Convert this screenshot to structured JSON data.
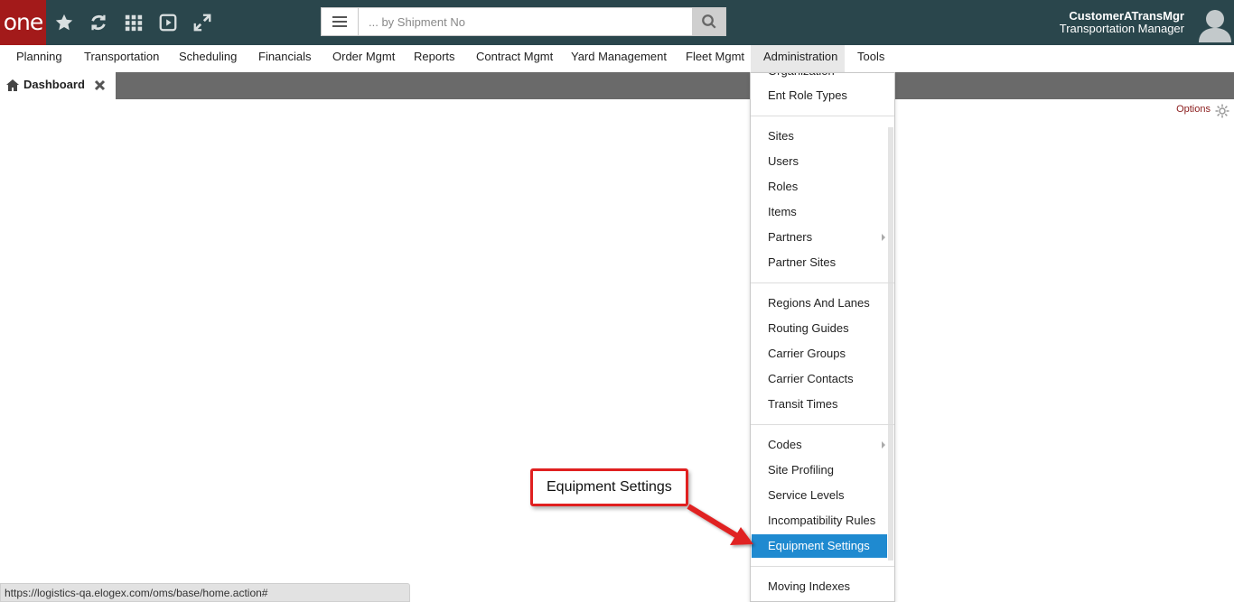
{
  "header": {
    "logo_text": "one",
    "search_placeholder": "... by Shipment No",
    "user_name": "CustomerATransMgr",
    "user_role": "Transportation Manager",
    "icons": [
      "star-icon",
      "refresh-icon",
      "apps-grid-icon",
      "play-icon",
      "expand-icon"
    ]
  },
  "nav": {
    "items": [
      {
        "label": "Planning"
      },
      {
        "label": "Transportation"
      },
      {
        "label": "Scheduling"
      },
      {
        "label": "Financials"
      },
      {
        "label": "Order Mgmt"
      },
      {
        "label": "Reports"
      },
      {
        "label": "Contract Mgmt"
      },
      {
        "label": "Yard Management"
      },
      {
        "label": "Fleet Mgmt"
      },
      {
        "label": "Administration"
      },
      {
        "label": "Tools"
      }
    ],
    "active": "Administration"
  },
  "tabs": {
    "dashboard_label": "Dashboard"
  },
  "options_label": "Options",
  "dropdown": {
    "items": [
      {
        "label": "Organization"
      },
      {
        "label": "Ent Role Types"
      },
      {
        "label": "Sites"
      },
      {
        "label": "Users"
      },
      {
        "label": "Roles"
      },
      {
        "label": "Items"
      },
      {
        "label": "Partners"
      },
      {
        "label": "Partner Sites"
      },
      {
        "label": "Regions And Lanes"
      },
      {
        "label": "Routing Guides"
      },
      {
        "label": "Carrier Groups"
      },
      {
        "label": "Carrier Contacts"
      },
      {
        "label": "Transit Times"
      },
      {
        "label": "Codes"
      },
      {
        "label": "Site Profiling"
      },
      {
        "label": "Service Levels"
      },
      {
        "label": "Incompatibility Rules"
      },
      {
        "label": "Equipment Settings"
      },
      {
        "label": "Moving Indexes"
      }
    ],
    "selected": "Equipment Settings"
  },
  "callout": {
    "text": "Equipment Settings",
    "color": "#e02020"
  },
  "status_url": "https://logistics-qa.elogex.com/oms/base/home.action#",
  "colors": {
    "header_bg": "#2a464c",
    "logo_bg": "#a31a1a",
    "selected_bg": "#1f8ad0",
    "tabbar_bg": "#6a6a6a"
  }
}
